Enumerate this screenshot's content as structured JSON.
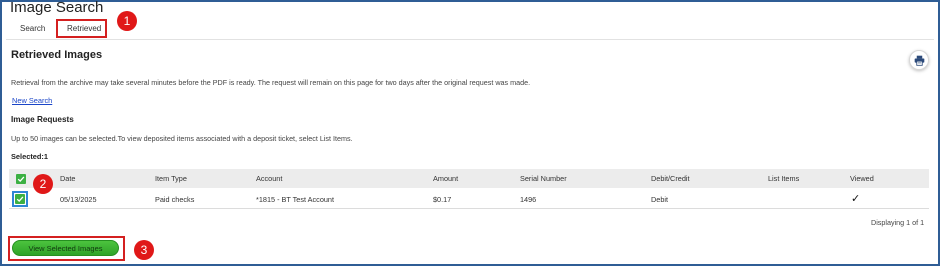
{
  "page": {
    "title": "Image Search",
    "tabs": [
      {
        "label": "Search"
      },
      {
        "label": "Retrieved"
      }
    ],
    "heading": "Retrieved Images",
    "info_text": "Retrieval from the archive may take several minutes before the PDF is ready. The request will remain on this page for two days after the original request was made.",
    "new_search_link": "New Search",
    "section_heading": "Image Requests",
    "section_info": "Up to 50 images can be selected.To view deposited items associated with a deposit ticket, select List Items.",
    "selected_label": "Selected:1",
    "print_icon": "printer-icon"
  },
  "annotations": {
    "callout1": "1",
    "callout2": "2",
    "callout3": "3"
  },
  "table": {
    "headers": [
      "Date",
      "Item Type",
      "Account",
      "Amount",
      "Serial Number",
      "Debit/Credit",
      "List Items",
      "Viewed"
    ],
    "rows": [
      {
        "date": "05/13/2025",
        "item_type": "Paid checks",
        "account": "*1815 - BT Test Account",
        "amount": "$0.17",
        "serial": "1496",
        "debit_credit": "Debit",
        "list_items": "",
        "viewed": "✓",
        "checked": true
      }
    ],
    "pager": "Displaying 1 of 1"
  },
  "actions": {
    "view_selected": "View Selected Images"
  },
  "colors": {
    "accent_green": "#3cb043",
    "callout_red": "#e01818",
    "frame_blue": "#2f5d95",
    "link_blue": "#1a45c8"
  }
}
